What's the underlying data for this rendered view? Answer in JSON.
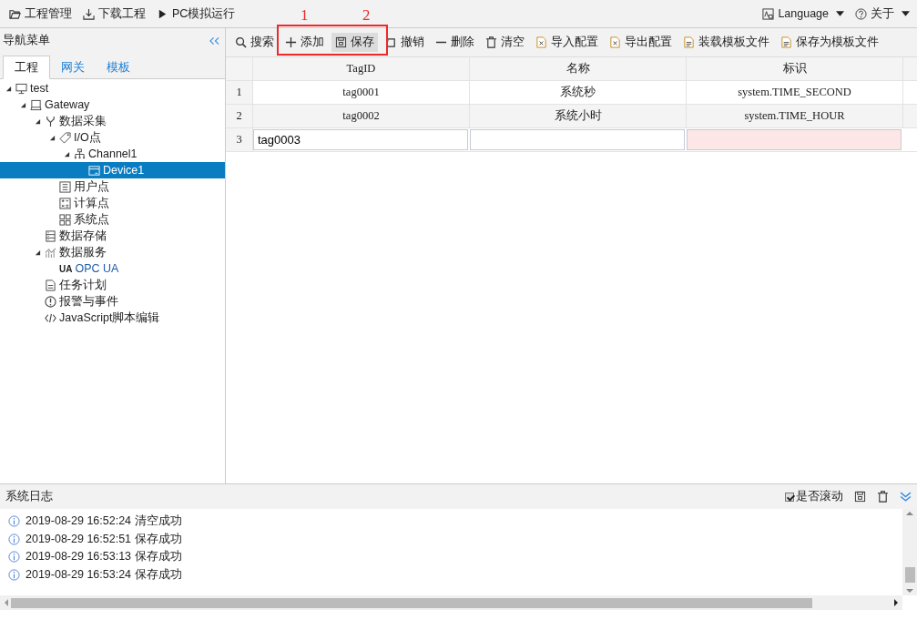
{
  "menubar": {
    "items": [
      {
        "label": "工程管理",
        "kind": "folder"
      },
      {
        "label": "下载工程",
        "kind": "download"
      },
      {
        "label": "PC模拟运行",
        "kind": "play"
      }
    ],
    "right": [
      {
        "label": "Language",
        "kind": "language"
      },
      {
        "label": "关于",
        "kind": "help"
      }
    ]
  },
  "sidebar": {
    "title": "导航菜单",
    "tabs": [
      {
        "label": "工程",
        "selected": true
      },
      {
        "label": "网关",
        "selected": false
      },
      {
        "label": "模板",
        "selected": false
      }
    ],
    "tree": [
      {
        "label": "test",
        "kind": "monitor",
        "expanded": true,
        "selected": false,
        "children": [
          {
            "label": "Gateway",
            "kind": "laptop",
            "expanded": true,
            "selected": false,
            "children": [
              {
                "label": "数据采集",
                "kind": "fork",
                "expanded": true,
                "selected": false,
                "children": [
                  {
                    "label": "I/O点",
                    "kind": "tag",
                    "expanded": true,
                    "selected": false,
                    "children": [
                      {
                        "label": "Channel1",
                        "kind": "network",
                        "expanded": true,
                        "selected": false,
                        "children": [
                          {
                            "label": "Device1",
                            "kind": "device",
                            "selected": true
                          }
                        ]
                      }
                    ]
                  },
                  {
                    "label": "用户点",
                    "kind": "list",
                    "selected": false
                  },
                  {
                    "label": "计算点",
                    "kind": "calc",
                    "selected": false
                  },
                  {
                    "label": "系统点",
                    "kind": "grid",
                    "selected": false
                  }
                ]
              },
              {
                "label": "数据存储",
                "kind": "storage",
                "selected": false
              },
              {
                "label": "数据服务",
                "kind": "chart",
                "expanded": true,
                "selected": false,
                "children": [
                  {
                    "label": "OPC UA",
                    "kind": "ua",
                    "badge": "UA",
                    "selected": false
                  }
                ]
              },
              {
                "label": "任务计划",
                "kind": "doc",
                "selected": false
              },
              {
                "label": "报警与事件",
                "kind": "alert",
                "selected": false
              },
              {
                "label": "JavaScript脚本编辑",
                "kind": "code",
                "selected": false
              }
            ]
          }
        ]
      }
    ]
  },
  "toolbar": {
    "items": [
      {
        "label": "搜索",
        "kind": "search",
        "highlighted": false
      },
      {
        "label": "添加",
        "kind": "plus",
        "highlighted": false
      },
      {
        "label": "保存",
        "kind": "save",
        "highlighted": true
      },
      {
        "label": "撤销",
        "kind": "undo",
        "highlighted": false
      },
      {
        "label": "删除",
        "kind": "minus",
        "highlighted": false
      },
      {
        "label": "清空",
        "kind": "trash",
        "highlighted": false
      },
      {
        "label": "导入配置",
        "kind": "excel",
        "highlighted": false
      },
      {
        "label": "导出配置",
        "kind": "excel",
        "highlighted": false
      },
      {
        "label": "装载模板文件",
        "kind": "file",
        "highlighted": false
      },
      {
        "label": "保存为模板文件",
        "kind": "file",
        "highlighted": false
      }
    ]
  },
  "annotation": {
    "labels": [
      "1",
      "2"
    ]
  },
  "table": {
    "columns": [
      "TagID",
      "名称",
      "标识"
    ],
    "rows": [
      {
        "number": "1",
        "editing": false,
        "cells": [
          {
            "text": "tag0001"
          },
          {
            "text": "系统秒"
          },
          {
            "text": "system.TIME_SECOND"
          }
        ]
      },
      {
        "number": "2",
        "editing": false,
        "cells": [
          {
            "text": "tag0002"
          },
          {
            "text": "系统小时"
          },
          {
            "text": "system.TIME_HOUR"
          }
        ]
      },
      {
        "number": "3",
        "editing": true,
        "cells": [
          {
            "text": "tag0003",
            "invalid": false
          },
          {
            "invalid": false
          },
          {
            "invalid": true
          }
        ]
      }
    ]
  },
  "log": {
    "title": "系统日志",
    "autoscroll": {
      "label": "是否滚动",
      "checked": true
    },
    "entries": [
      {
        "text": "2019-08-29 16:52:24 清空成功"
      },
      {
        "text": "2019-08-29 16:52:51 保存成功"
      },
      {
        "text": "2019-08-29 16:53:13 保存成功"
      },
      {
        "text": "2019-08-29 16:53:24 保存成功"
      }
    ]
  }
}
